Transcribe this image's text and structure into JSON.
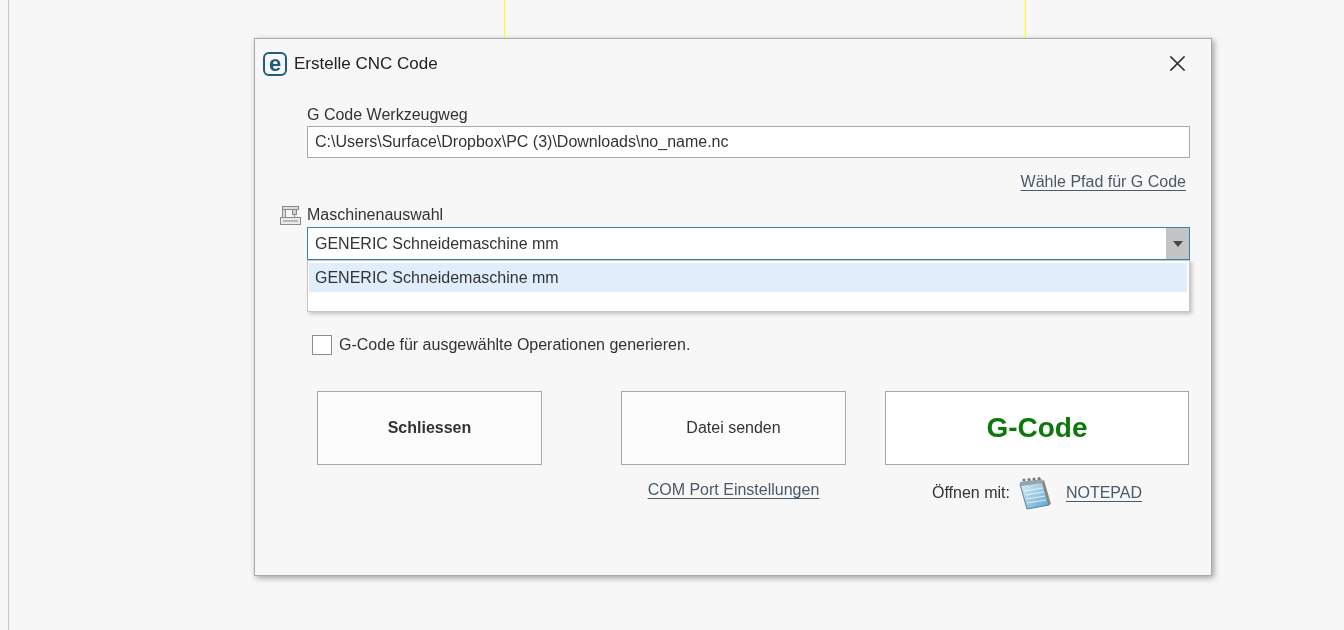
{
  "window": {
    "logo": "e",
    "title": "Erstelle CNC Code"
  },
  "toolpath": {
    "label": "G Code Werkzeugweg",
    "value": "C:\\Users\\Surface\\Dropbox\\PC (3)\\Downloads\\no_name.nc",
    "link": "Wähle Pfad für G Code"
  },
  "machine": {
    "label": "Maschinenauswahl",
    "value": "GENERIC Schneidemaschine mm",
    "expanded": true,
    "options": [
      {
        "label": "GENERIC Schneidemaschine mm",
        "selected": true
      }
    ]
  },
  "option": {
    "label": "G-Code für ausgewählte Operationen generieren.",
    "checked": false
  },
  "actions": [
    {
      "kind": "bold",
      "label": "Schliessen"
    },
    {
      "kind": "plain",
      "label": "Datei senden",
      "link": "COM Port Einstellungen"
    },
    {
      "kind": "primary",
      "label": "G-Code",
      "open_with": {
        "label": "Öffnen mit:",
        "link": "NOTEPAD"
      }
    }
  ]
}
